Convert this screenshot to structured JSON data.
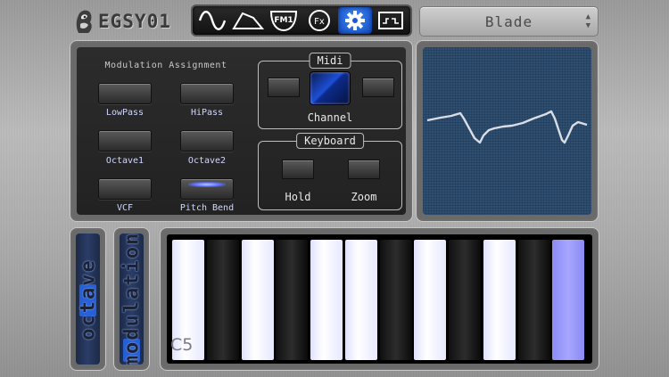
{
  "app": {
    "logo_text": "EGSY01",
    "logo_icon": "dog-head-logo-icon"
  },
  "toolbar": {
    "tabs": [
      {
        "icon": "sine-wave-icon",
        "label": "",
        "active": false
      },
      {
        "icon": "envelope-icon",
        "label": "",
        "active": false
      },
      {
        "icon": "fm-icon",
        "label": "FM1",
        "active": false
      },
      {
        "icon": "fx-icon",
        "label": "Fx",
        "active": false
      },
      {
        "icon": "gear-icon",
        "label": "",
        "active": true
      },
      {
        "icon": "sequencer-icon",
        "label": "",
        "active": false
      }
    ]
  },
  "preset": {
    "value": "Blade",
    "icon": "up-down-stepper-icon"
  },
  "modulation_assignment": {
    "title": "Modulation Assignment",
    "buttons": [
      {
        "label": "LowPass",
        "lit": false
      },
      {
        "label": "HiPass",
        "lit": false
      },
      {
        "label": "Octave1",
        "lit": false
      },
      {
        "label": "Octave2",
        "lit": false
      },
      {
        "label": "VCF",
        "lit": false
      },
      {
        "label": "Pitch Bend",
        "lit": true
      }
    ]
  },
  "midi": {
    "title": "Midi",
    "channel_label": "Channel"
  },
  "keyboard_group": {
    "title": "Keyboard",
    "hold_label": "Hold",
    "zoom_label": "Zoom"
  },
  "scope": {
    "icon": "waveform-display",
    "line_color": "#d8dde6",
    "background": "#2e4f72"
  },
  "octave_slider": {
    "label": "octave",
    "level": 0.5
  },
  "modulation_slider": {
    "label": "modulation",
    "level": 0.05
  },
  "keyboard": {
    "start_note_label": "C5",
    "pressed_white_key_index": 6,
    "white_key_count": 11
  },
  "colors": {
    "accent": "#2a66ff",
    "key_pressed": "#a6a6ff"
  }
}
